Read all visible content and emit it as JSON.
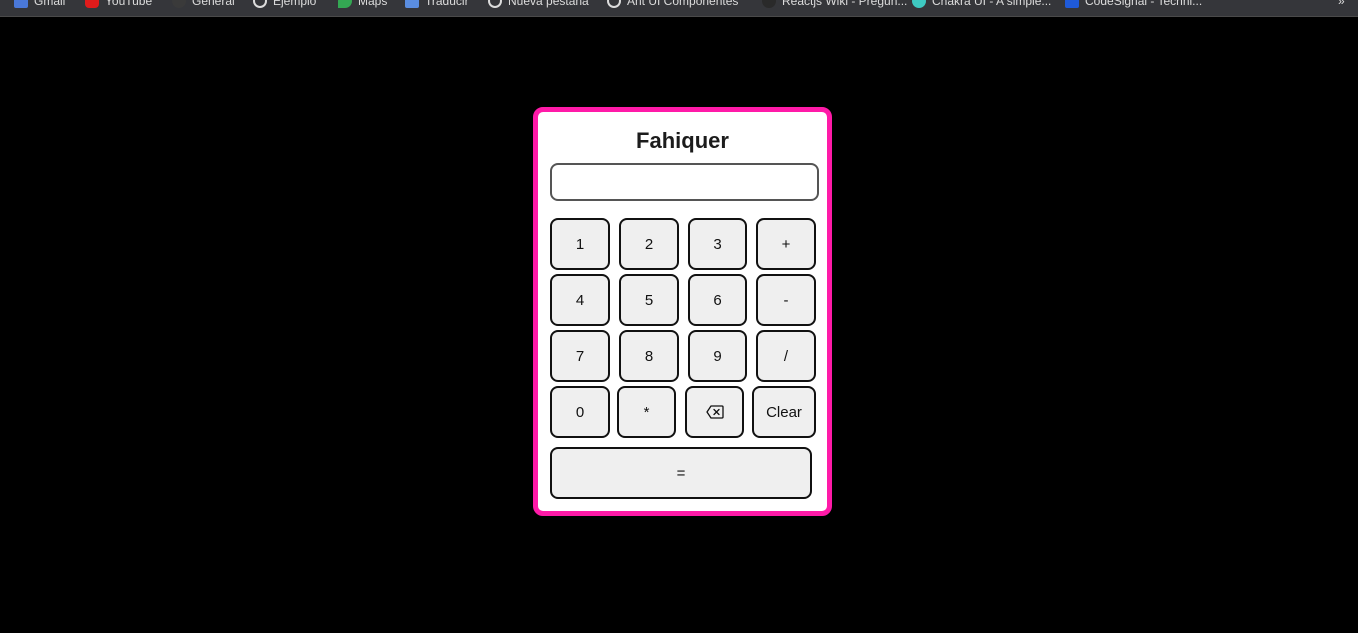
{
  "bookmarks": [
    {
      "label": "Gmail",
      "icon": "gmail-icon",
      "color": "#4a78d8"
    },
    {
      "label": "YouTube",
      "icon": "youtube-icon",
      "color": "#e01b1b"
    },
    {
      "label": "General",
      "icon": "github-icon",
      "color": "#3a3a3a"
    },
    {
      "label": "Ejemplo",
      "icon": "globe-icon",
      "color": "#dcdcdc"
    },
    {
      "label": "Maps",
      "icon": "maps-icon",
      "color": "#34a853"
    },
    {
      "label": "Traducir",
      "icon": "translate-icon",
      "color": "#5a8de0"
    },
    {
      "label": "Nueva pestaña",
      "icon": "globe-icon",
      "color": "#dcdcdc"
    },
    {
      "label": "Ant UI Componentes",
      "icon": "globe-icon",
      "color": "#dcdcdc"
    },
    {
      "label": "Reactjs Wiki - Pregun...",
      "icon": "react-icon",
      "color": "#2a2a2a"
    },
    {
      "label": "Chakra UI - A simple...",
      "icon": "chakra-icon",
      "color": "#3ec9c1"
    },
    {
      "label": "CodeSignal - Techni...",
      "icon": "codesignal-icon",
      "color": "#1f5ad8"
    }
  ],
  "bookmarks_more": "»",
  "calculator": {
    "title": "Fahiquer",
    "display_value": "",
    "accent_color": "#ff1aa8",
    "keys": [
      {
        "label": "1"
      },
      {
        "label": "2"
      },
      {
        "label": "3"
      },
      {
        "label": "+"
      },
      {
        "label": "4"
      },
      {
        "label": "5"
      },
      {
        "label": "6"
      },
      {
        "label": "-"
      },
      {
        "label": "7"
      },
      {
        "label": "8"
      },
      {
        "label": "9"
      },
      {
        "label": "/"
      },
      {
        "label": "0"
      },
      {
        "label": "*"
      },
      {
        "label": "⌫",
        "icon": "backspace-icon"
      },
      {
        "label": "Clear"
      },
      {
        "label": "="
      }
    ]
  }
}
